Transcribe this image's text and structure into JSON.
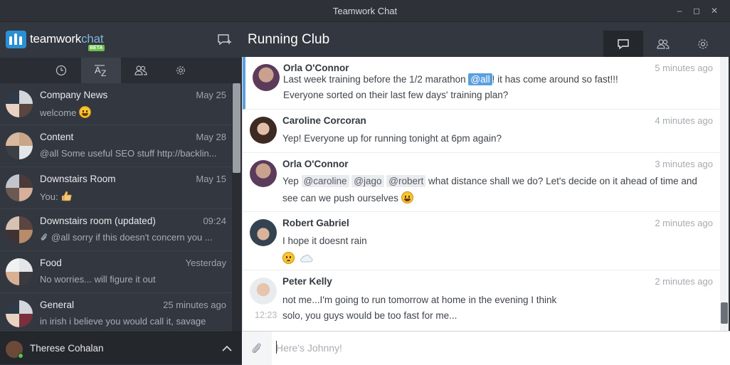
{
  "window": {
    "title": "Teamwork Chat"
  },
  "brand": {
    "name": "teamwork",
    "suffix": "chat",
    "badge": "BETA"
  },
  "sidebar": {
    "tabs": [
      {
        "icon": "clock-icon",
        "active": false
      },
      {
        "icon": "sort-az-icon",
        "active": true
      },
      {
        "icon": "people-icon",
        "active": false
      },
      {
        "icon": "gear-icon",
        "active": false
      }
    ],
    "conversations": [
      {
        "name": "Company News",
        "time": "May 25",
        "preview": "welcome",
        "emoji": "grin"
      },
      {
        "name": "Content",
        "time": "May 28",
        "preview": "@all Some useful SEO stuff http://backlin..."
      },
      {
        "name": "Downstairs Room",
        "time": "May 15",
        "preview": "You: ",
        "emoji": "thumbs-up"
      },
      {
        "name": "Downstairs room (updated)",
        "time": "09:24",
        "preview": "@all sorry if this doesn't concern you ...",
        "attachment": true
      },
      {
        "name": "Food",
        "time": "Yesterday",
        "preview": "No worries... will figure it out"
      },
      {
        "name": "General",
        "time": "25 minutes ago",
        "preview": "in irish i believe you would call it, savage"
      }
    ],
    "current_user": {
      "name": "Therese Cohalan",
      "status": "online"
    }
  },
  "chat": {
    "title": "Running Club",
    "header_tabs": [
      {
        "icon": "chat-bubble-icon",
        "active": true
      },
      {
        "icon": "people-icon",
        "active": false
      },
      {
        "icon": "gear-icon",
        "active": false
      }
    ],
    "messages": [
      {
        "author": "Orla O'Connor",
        "ago": "5 minutes ago",
        "line1_pre": "Last week training before the 1/2 marathon ",
        "line1_mention": "@all",
        "line1_post": "! it has come around so fast!!!",
        "line2": "Everyone sorted on their last few days' training plan?"
      },
      {
        "author": "Caroline Corcoran",
        "ago": "4 minutes ago",
        "line1": "Yep! Everyone up for running tonight at 6pm again?"
      },
      {
        "author": "Orla O'Connor",
        "ago": "3 minutes ago",
        "line1_pre": "Yep ",
        "mentions": [
          "@caroline",
          "@jago",
          "@robert"
        ],
        "line1_post": " what distance shall we do? Let's decide on it ahead of time and",
        "line2": "see can we push ourselves "
      },
      {
        "author": "Robert Gabriel",
        "ago": "2 minutes ago",
        "line1": "I hope it doesnt rain"
      },
      {
        "author": "Peter Kelly",
        "ago": "2 minutes ago",
        "line1": "not me...I'm going to run tomorrow at home in the evening I think",
        "side_time": "12:23",
        "line2": "solo, you guys would be too fast for me..."
      }
    ],
    "composer": {
      "placeholder": "Here's Johnny!"
    }
  },
  "colors": {
    "accent": "#5aa0de",
    "sidebar_bg": "#33373f",
    "online": "#5cc04b"
  }
}
